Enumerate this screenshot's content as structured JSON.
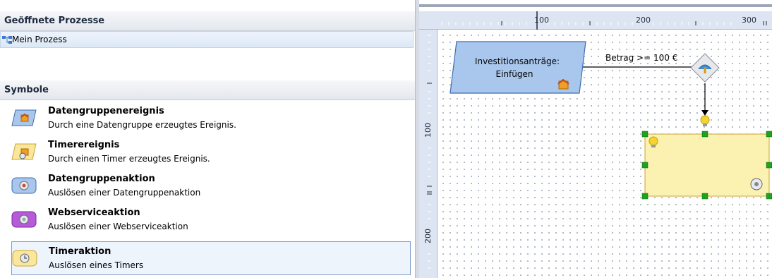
{
  "processes": {
    "header": "Geöffnete Prozesse",
    "items": [
      {
        "label": "Mein Prozess"
      }
    ]
  },
  "symbols": {
    "header": "Symbole",
    "items": [
      {
        "title": "Datengruppenereignis",
        "desc": "Durch eine Datengruppe erzeugtes Ereignis.",
        "icon": "datagroup-event-icon"
      },
      {
        "title": "Timerereignis",
        "desc": "Durch einen Timer erzeugtes Ereignis.",
        "icon": "timer-event-icon"
      },
      {
        "title": "Datengruppenaktion",
        "desc": "Auslösen einer Datengruppenaktion",
        "icon": "datagroup-action-icon"
      },
      {
        "title": "Webserviceaktion",
        "desc": "Auslösen einer Webserviceaktion",
        "icon": "webservice-action-icon"
      },
      {
        "title": "Timeraktion",
        "desc": "Auslösen eines Timers",
        "icon": "timer-action-icon"
      }
    ]
  },
  "canvas": {
    "ruler_top_labels": [
      "100",
      "200",
      "300"
    ],
    "ruler_left_labels": [
      "100",
      "200"
    ],
    "event_node": {
      "line1": "Investitionsanträge:",
      "line2": "Einfügen"
    },
    "condition_label": "Betrag >= 100 €"
  },
  "colors": {
    "selection": "#7d9bc9",
    "event_fill": "#a9c7ec",
    "action_fill": "#fbf1b0",
    "handle": "#1ea31e"
  }
}
